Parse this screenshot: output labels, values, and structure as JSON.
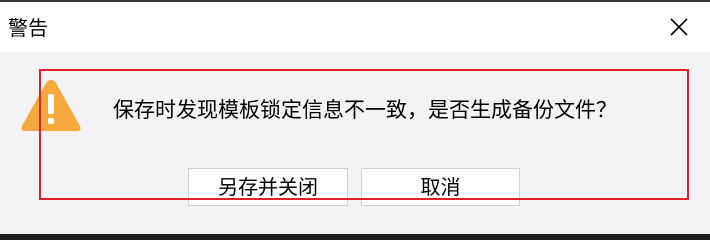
{
  "dialog": {
    "title": "警告",
    "message": "保存时发现模板锁定信息不一致，是否生成备份文件？",
    "buttons": {
      "save_as_close": "另存并关闭",
      "cancel": "取消"
    },
    "icons": {
      "warning": "warning-icon",
      "close": "close-icon"
    },
    "colors": {
      "warning": "#f5a93c",
      "highlight_border": "#e0202a"
    }
  }
}
